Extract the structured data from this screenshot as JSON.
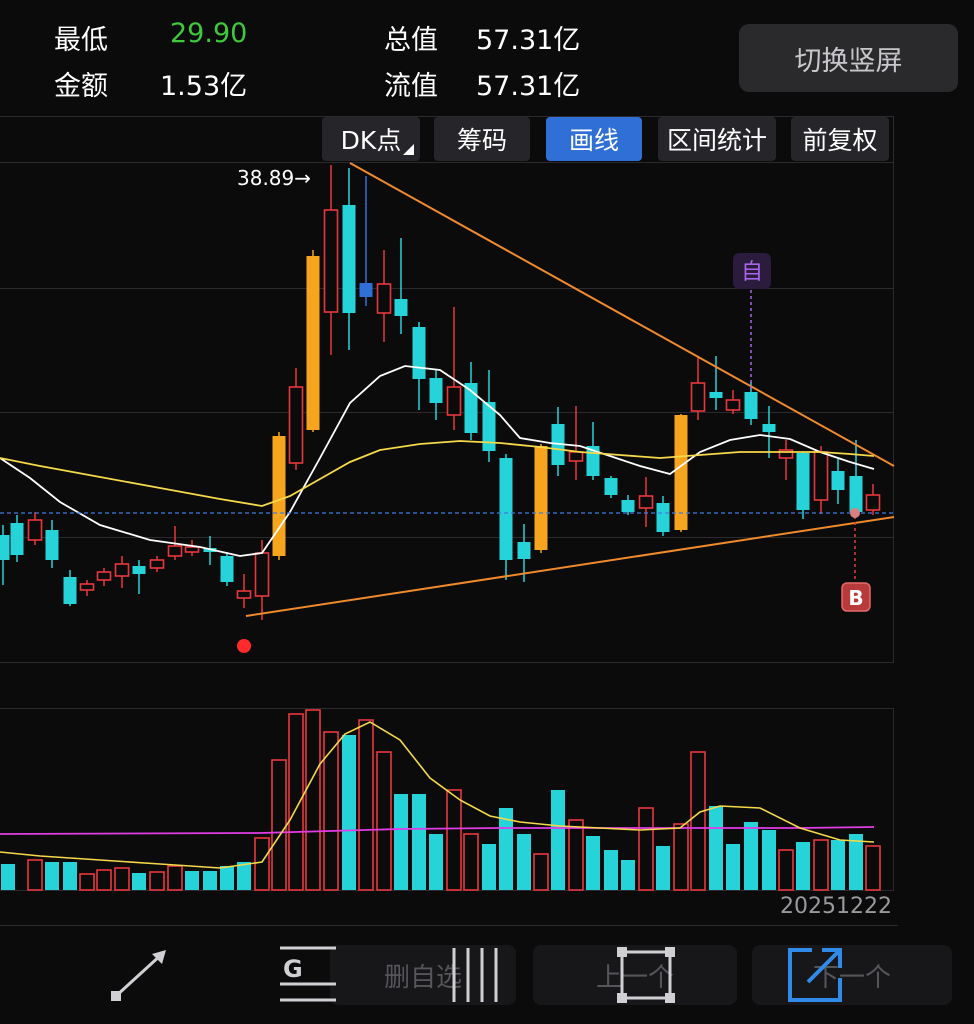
{
  "stats": {
    "low_label": "最低",
    "low_value": "29.90",
    "amount_label": "金额",
    "amount_value": "1.53亿",
    "total_cap_label": "总值",
    "total_cap_value": "57.31亿",
    "float_cap_label": "流值",
    "float_cap_value": "57.31亿"
  },
  "switch_button": "切换竖屏",
  "tabs": {
    "dk": "DK点",
    "chips": "筹码",
    "draw": "画线",
    "interval": "区间统计",
    "adjust": "前复权"
  },
  "active_tab": "画线",
  "annotations": {
    "high_price": "38.89→",
    "self_marker": "自",
    "buy_marker": "B"
  },
  "date": "20251222",
  "toolbar": {
    "delete_watch": "删自选",
    "prev": "上一个",
    "next": "下一个",
    "g_label": "G"
  },
  "colors": {
    "up": "#e8383d",
    "down": "#26d3d8",
    "limit_up": "#f7a51e",
    "ma_white": "#ffffff",
    "ma_yellow": "#f5d94a",
    "trendline": "#f08a2c",
    "vol_avg": "#e23ce6",
    "accent": "#2f6fd6",
    "low_green": "#3ec83c",
    "self_marker": "#a866e8",
    "buy_marker": "#e8383d"
  },
  "icons": [
    "line-tool-icon",
    "g-tool-icon",
    "parallel-lines-icon",
    "rectangle-tool-icon",
    "share-icon"
  ]
}
